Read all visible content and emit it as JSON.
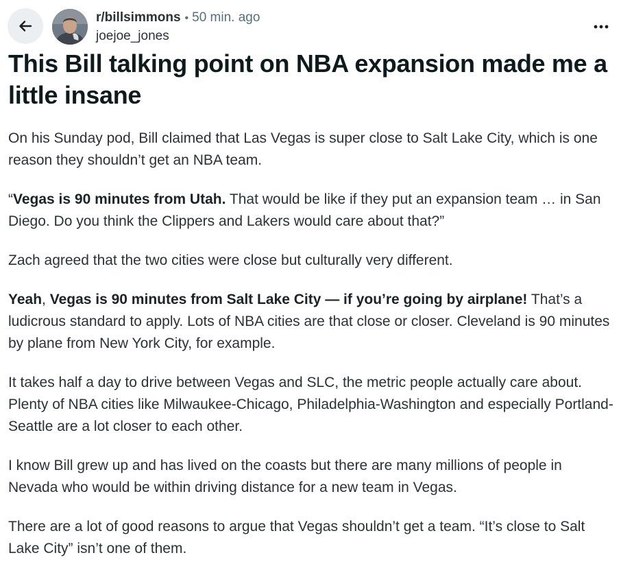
{
  "post": {
    "subreddit": "r/billsimmons",
    "separator": "•",
    "time_ago": "50 min. ago",
    "author": "joejoe_jones",
    "title": "This Bill talking point on NBA expansion made me a little insane",
    "body": {
      "p1": "On his Sunday pod, Bill claimed that Las Vegas is super close to Salt Lake City, which is one reason they shouldn’t get an NBA team.",
      "p2_open_quote": "“",
      "p2_bold": "Vegas is 90 minutes from Utah.",
      "p2_rest": " That would be like if they put an expansion team … in San Diego. Do you think the Clippers and Lakers would care about that?”",
      "p3": "Zach agreed that the two cities were close but culturally very different.",
      "p4_bold_a": "Yeah",
      "p4_comma": ", ",
      "p4_bold_b": "Vegas is 90 minutes from Salt Lake City — if you’re going by airplane!",
      "p4_rest": " That’s a ludicrous standard to apply. Lots of NBA cities are that close or closer. Cleveland is 90 minutes by plane from New York City, for example.",
      "p5": "It takes half a day to drive between Vegas and SLC, the metric people actually care about. Plenty of NBA cities like Milwaukee-Chicago, Philadelphia-Washington and especially Portland-Seattle are a lot closer to each other.",
      "p6": "I know Bill grew up and has lived on the coasts but there are many millions of people in Nevada who would be within driving distance for a new team in Vegas.",
      "p7": "There are a lot of good reasons to argue that Vegas shouldn’t get a team. “It’s close to Salt Lake City” isn’t one of them."
    }
  },
  "icons": {
    "back": "arrow-left-icon",
    "more": "more-horizontal-icon",
    "avatar": "user-avatar"
  },
  "colors": {
    "text_primary": "#1c1c1c",
    "text_secondary": "#576f76",
    "back_button_bg": "#eceff1"
  }
}
